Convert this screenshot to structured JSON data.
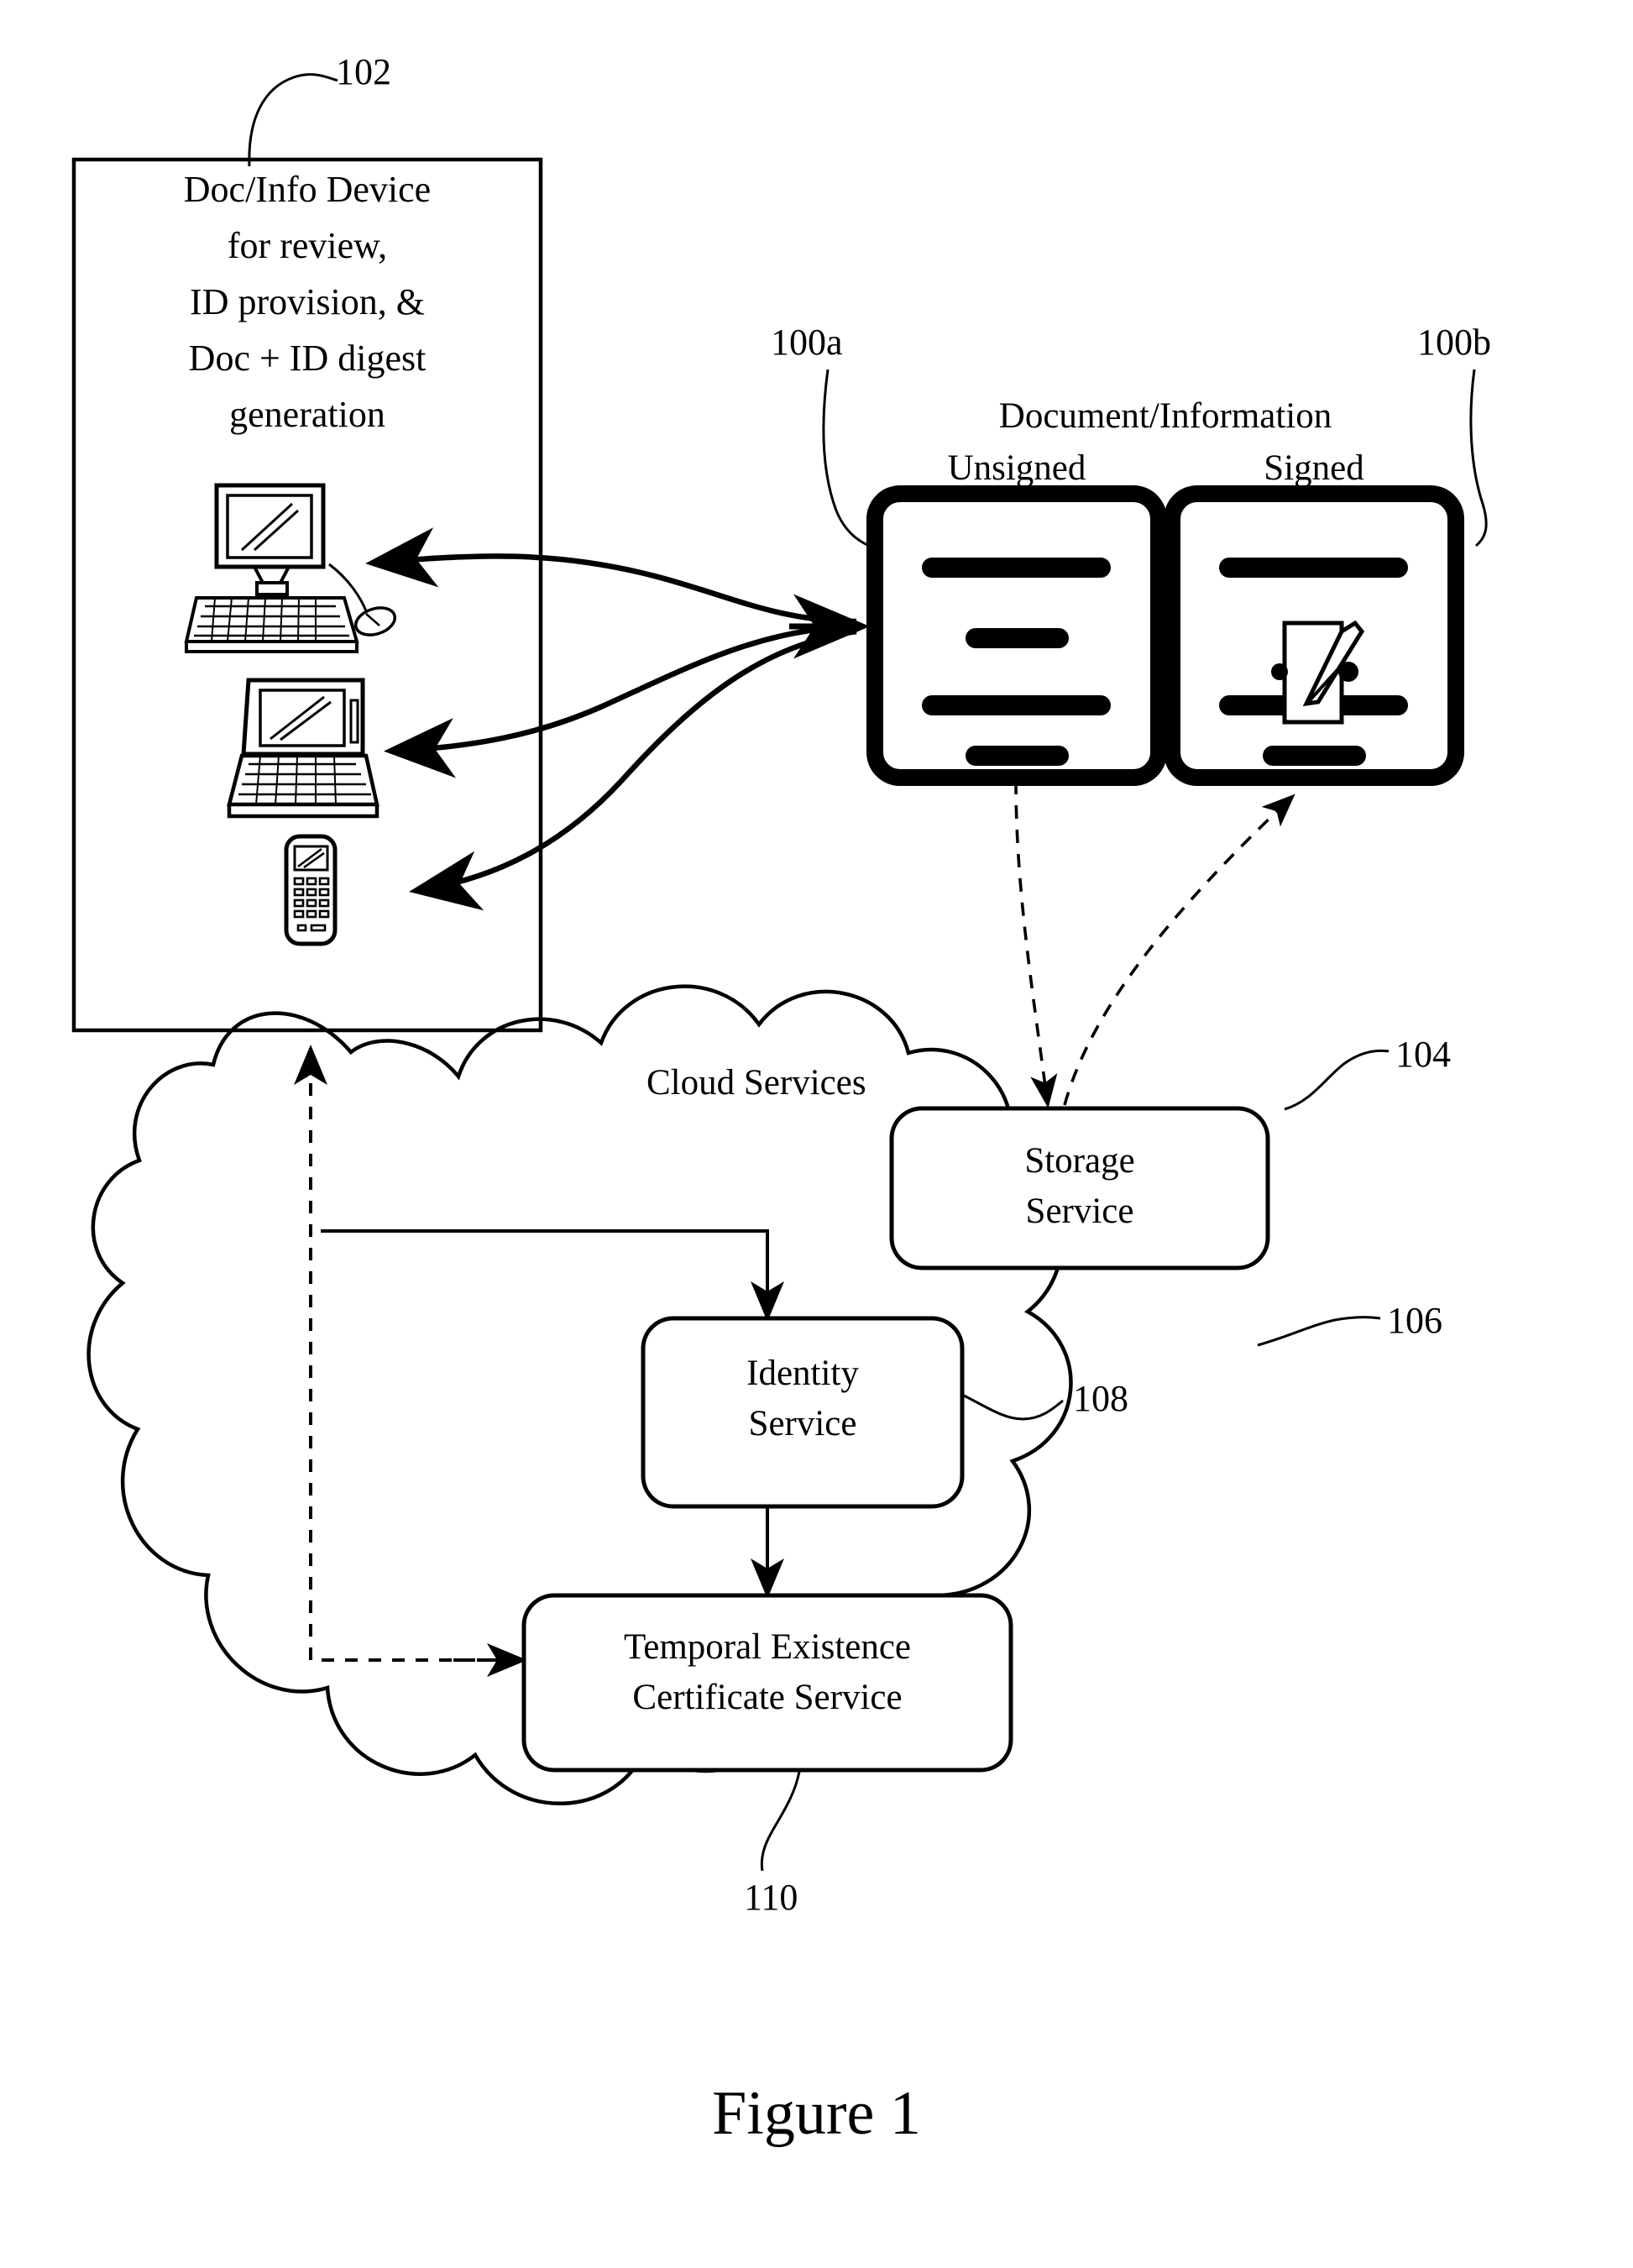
{
  "figure": {
    "caption": "Figure 1"
  },
  "device_box": {
    "ref": "102",
    "lines": [
      "Doc/Info Device",
      "for review,",
      "ID provision, &",
      "Doc + ID digest",
      "generation"
    ],
    "devices": [
      {
        "name": "desktop-computer-icon"
      },
      {
        "name": "laptop-computer-icon"
      },
      {
        "name": "mobile-phone-icon"
      }
    ]
  },
  "documents": {
    "header": "Document/Information",
    "unsigned": {
      "ref": "100a",
      "label": "Unsigned",
      "lines": 4
    },
    "signed": {
      "ref": "100b",
      "label": "Signed",
      "lines": 4,
      "icon": "signature-pen-icon"
    }
  },
  "cloud": {
    "label": "Cloud Services",
    "ref": "106",
    "services": [
      {
        "id": "storage",
        "ref": "104",
        "lines": [
          "Storage",
          "Service"
        ]
      },
      {
        "id": "identity",
        "ref": "108",
        "lines": [
          "Identity",
          "Service"
        ]
      },
      {
        "id": "temporal",
        "ref": "110",
        "lines": [
          "Temporal Existence",
          "Certificate Service"
        ]
      }
    ]
  },
  "colors": {
    "ink": "#000000",
    "paper": "#ffffff"
  }
}
